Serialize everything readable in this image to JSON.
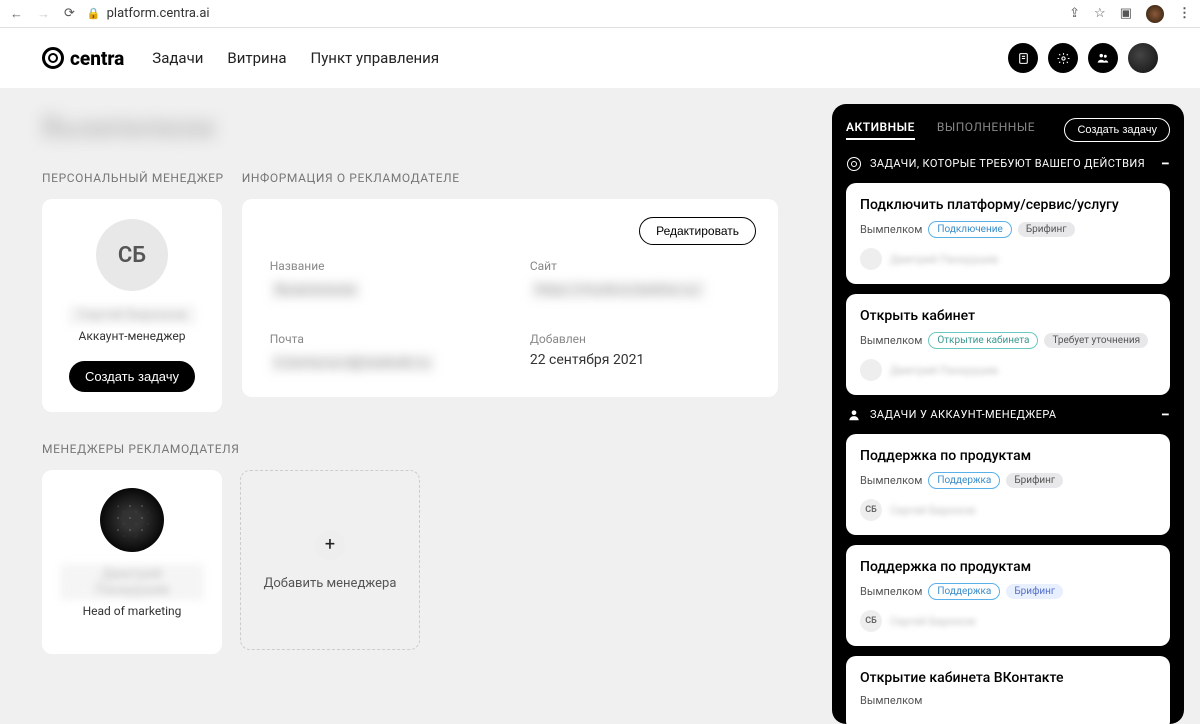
{
  "browser": {
    "url": "platform.centra.ai"
  },
  "header": {
    "brand": "centra",
    "nav": [
      "Задачи",
      "Витрина",
      "Пункт управления"
    ]
  },
  "page": {
    "title": "Вымпелком",
    "sections": {
      "personal_manager": "ПЕРСОНАЛЬНЫЙ МЕНЕДЖЕР",
      "advertiser_info": "ИНФОРМАЦИЯ О РЕКЛАМОДАТЕЛЕ",
      "advertiser_managers": "МЕНЕДЖЕРЫ РЕКЛАМОДАТЕЛЯ"
    }
  },
  "personal_manager": {
    "initials": "СБ",
    "name": "Сергей Бирюков",
    "role": "Аккаунт-менеджер",
    "cta": "Создать задачу"
  },
  "info": {
    "edit": "Редактировать",
    "fields": {
      "name_label": "Название",
      "name_value": "Вымпелком",
      "site_label": "Сайт",
      "site_value": "https://moskva.beeline.ru/",
      "email_label": "Почта",
      "email_value": "k.borisova-d@realweb.ru",
      "added_label": "Добавлен",
      "added_value": "22 сентября 2021"
    }
  },
  "adv_managers": {
    "items": [
      {
        "name": "Дмитрий Панкрушев",
        "role": "Head of marketing"
      }
    ],
    "add_label": "Добавить менеджера"
  },
  "sidebar": {
    "tabs": {
      "active": "АКТИВНЫЕ",
      "done": "ВЫПОЛНЕННЫЕ"
    },
    "create": "Создать задачу",
    "sections": {
      "action_required": "ЗАДАЧИ, КОТОРЫЕ ТРЕБУЮТ ВАШЕГО ДЕЙСТВИЯ",
      "at_manager": "ЗАДАЧИ У АККАУНТ-МЕНЕДЖЕРА"
    },
    "tasks_action": [
      {
        "title": "Подключить платформу/сервис/услугу",
        "company": "Вымпелком",
        "tags": [
          {
            "text": "Подключение",
            "style": "blue-o"
          },
          {
            "text": "Брифинг",
            "style": "grey-f"
          }
        ],
        "assignee": {
          "initials": "",
          "name": "Дмитрий Панкрушев"
        }
      },
      {
        "title": "Открыть кабинет",
        "company": "Вымпелком",
        "tags": [
          {
            "text": "Открытие кабинета",
            "style": "teal-o"
          },
          {
            "text": "Требует уточнения",
            "style": "grey-f"
          }
        ],
        "assignee": {
          "initials": "",
          "name": "Дмитрий Панкрушев"
        }
      }
    ],
    "tasks_manager": [
      {
        "title": "Поддержка по продуктам",
        "company": "Вымпелком",
        "tags": [
          {
            "text": "Поддержка",
            "style": "blue-o"
          },
          {
            "text": "Брифинг",
            "style": "grey-f"
          }
        ],
        "assignee": {
          "initials": "СБ",
          "name": "Сергей Бирюков"
        }
      },
      {
        "title": "Поддержка по продуктам",
        "company": "Вымпелком",
        "tags": [
          {
            "text": "Поддержка",
            "style": "blue-o"
          },
          {
            "text": "Брифинг",
            "style": "blue-f"
          }
        ],
        "assignee": {
          "initials": "СБ",
          "name": "Сергей Бирюков"
        }
      },
      {
        "title": "Открытие кабинета ВКонтакте",
        "company": "Вымпелком",
        "tags": [],
        "assignee": {
          "initials": "",
          "name": ""
        }
      }
    ]
  }
}
